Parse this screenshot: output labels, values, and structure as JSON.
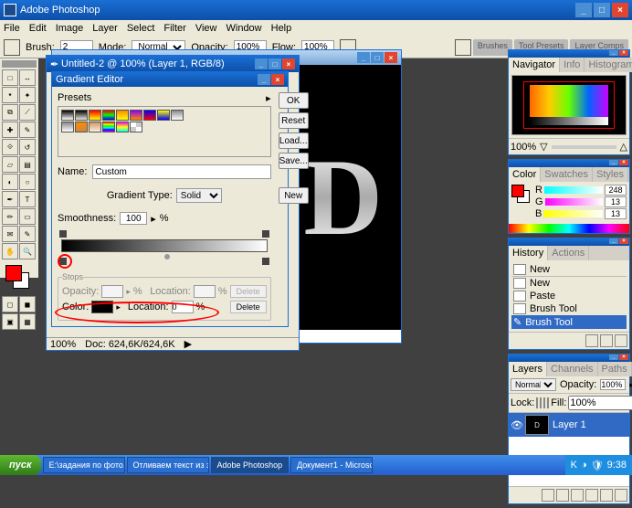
{
  "app": {
    "title": "Adobe Photoshop"
  },
  "menu": [
    "File",
    "Edit",
    "Image",
    "Layer",
    "Select",
    "Filter",
    "View",
    "Window",
    "Help"
  ],
  "options": {
    "brushLabel": "Brush:",
    "brushSize": "2",
    "modeLabel": "Mode:",
    "modeValue": "Normal",
    "opacityLabel": "Opacity:",
    "opacityValue": "100%",
    "flowLabel": "Flow:",
    "flowValue": "100%",
    "dockTabs": [
      "Brushes",
      "Tool Presets",
      "Layer Comps"
    ]
  },
  "docCanvas": {
    "letter": "D"
  },
  "untitled": {
    "title": "Untitled-2 @ 100% (Layer 1, RGB/8)",
    "zoom": "100%",
    "docsize": "Doc: 624,6K/624,6K"
  },
  "gradientEditor": {
    "title": "Gradient Editor",
    "presetsLabel": "Presets",
    "buttons": {
      "ok": "OK",
      "reset": "Reset",
      "load": "Load...",
      "save": "Save..."
    },
    "nameLabel": "Name:",
    "nameValue": "Custom",
    "newBtn": "New",
    "typeLabel": "Gradient Type:",
    "typeValue": "Solid",
    "smoothLabel": "Smoothness:",
    "smoothValue": "100",
    "pct": "%",
    "stopsLabel": "Stops",
    "opacityLabel": "Opacity:",
    "locationLabel": "Location:",
    "colorLabel": "Color:",
    "locationValue": "0",
    "deleteLabel": "Delete"
  },
  "navigator": {
    "tabs": [
      "Navigator",
      "Info",
      "Histogram"
    ],
    "zoom": "100%"
  },
  "color": {
    "tabs": [
      "Color",
      "Swatches",
      "Styles"
    ],
    "R": "248",
    "G": "13",
    "B": "13"
  },
  "history": {
    "tabs": [
      "History",
      "Actions"
    ],
    "doc": "New",
    "states": [
      "New",
      "Paste",
      "Brush Tool",
      "Brush Tool"
    ]
  },
  "layers": {
    "tabs": [
      "Layers",
      "Channels",
      "Paths"
    ],
    "blend": "Normal",
    "opacityLabel": "Opacity:",
    "opacityVal": "100%",
    "lockLabel": "Lock:",
    "fillLabel": "Fill:",
    "fillVal": "100%",
    "items": [
      {
        "name": "Layer 1"
      }
    ]
  },
  "taskbar": {
    "start": "пуск",
    "tasks": [
      "Е:\\задания по фото...",
      "Отливаем текст из з...",
      "Adobe Photoshop",
      "Документ1 - Microso..."
    ],
    "time": "9:38"
  }
}
